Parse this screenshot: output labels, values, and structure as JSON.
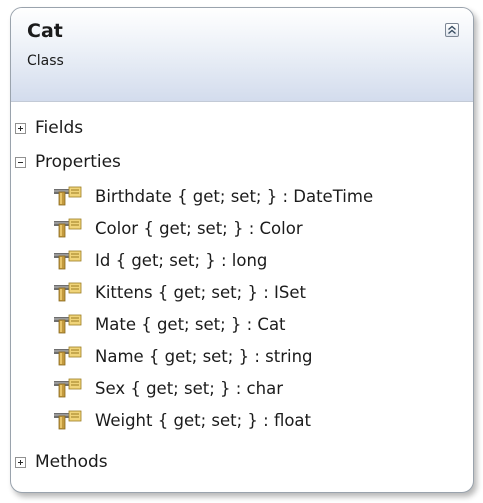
{
  "class_shape": {
    "name": "Cat",
    "kind": "Class"
  },
  "sections": {
    "fields": {
      "label": "Fields",
      "state": "collapsed"
    },
    "properties": {
      "label": "Properties",
      "state": "expanded"
    },
    "methods": {
      "label": "Methods",
      "state": "collapsed"
    }
  },
  "properties": [
    {
      "text": "Birthdate { get; set; } : DateTime",
      "icon": "property-icon"
    },
    {
      "text": "Color { get; set; } : Color",
      "icon": "property-icon"
    },
    {
      "text": "Id { get; set; } : long",
      "icon": "property-icon"
    },
    {
      "text": "Kittens { get; set; } : ISet",
      "icon": "property-icon"
    },
    {
      "text": "Mate { get; set; } : Cat",
      "icon": "property-icon"
    },
    {
      "text": "Name { get; set; } : string",
      "icon": "property-icon"
    },
    {
      "text": "Sex { get; set; } : char",
      "icon": "property-icon"
    },
    {
      "text": "Weight { get; set; } : float",
      "icon": "property-icon"
    }
  ],
  "icons": {
    "collapse_button": "double-chevron-up-icon",
    "expand": "plus-box-icon",
    "collapse": "minus-box-icon"
  },
  "colors": {
    "header_top": "#ffffff",
    "header_bottom": "#d3dced",
    "border": "#9aa3ad",
    "text": "#1b1b1b"
  }
}
